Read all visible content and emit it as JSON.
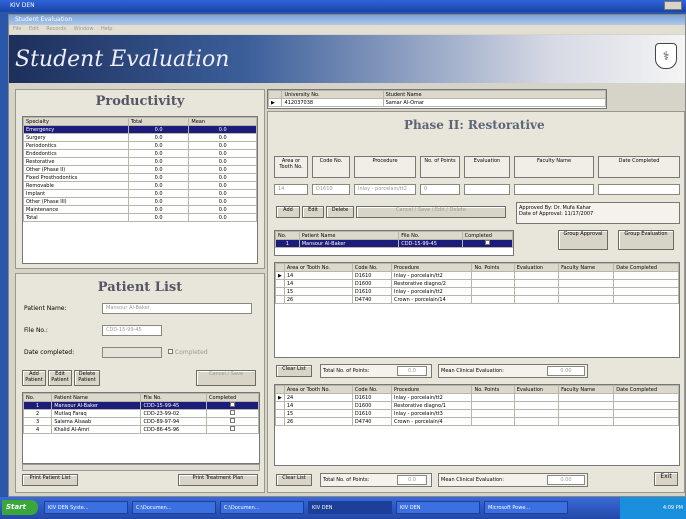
{
  "desktop": {
    "title": "KIV DEN"
  },
  "app": {
    "title": "Student Evaluation",
    "menu": [
      "File",
      "Edit",
      "Records",
      "Window",
      "Help"
    ],
    "banner_title": "Student Evaluation"
  },
  "productivity": {
    "title": "Productivity",
    "columns": [
      "Specialty",
      "Total",
      "Mean"
    ],
    "rows": [
      [
        "Emergency",
        "0.0",
        "0.0"
      ],
      [
        "Surgery",
        "0.0",
        "0.0"
      ],
      [
        "Periodontics",
        "0.0",
        "0.0"
      ],
      [
        "Endodontics",
        "0.0",
        "0.0"
      ],
      [
        "Restorative",
        "0.0",
        "0.0"
      ],
      [
        "Other (Phase II)",
        "0.0",
        "0.0"
      ],
      [
        "Fixed Prosthodontics",
        "0.0",
        "0.0"
      ],
      [
        "Removable",
        "0.0",
        "0.0"
      ],
      [
        "Implant",
        "0.0",
        "0.0"
      ],
      [
        "Other (Phase III)",
        "0.0",
        "0.0"
      ],
      [
        "Maintenance",
        "0.0",
        "0.0"
      ],
      [
        "Total",
        "0.0",
        "0.0"
      ]
    ]
  },
  "patient_list": {
    "title": "Patient List",
    "patient_name_label": "Patient Name:",
    "patient_name_value": "Mansour Al-Baker",
    "file_no_label": "File No.:",
    "file_no_value": "CDD-15-99-45",
    "date_completed_label": "Date completed:",
    "completed_label": "Completed",
    "buttons": {
      "add": "Add Patient",
      "edit": "Edit Patient",
      "delete": "Delete Patient",
      "cancel_save": "Cancel / Save"
    },
    "columns": [
      "No.",
      "Patient Name",
      "File No.",
      "Completed"
    ],
    "rows": [
      [
        "1",
        "Mansour Al-Baker",
        "CDD-15-99-45",
        ""
      ],
      [
        "2",
        "Mutlaq Faraq",
        "CDD-23-99-02",
        ""
      ],
      [
        "3",
        "Salema Alsaab",
        "CDD-89-97-94",
        ""
      ],
      [
        "4",
        "Khalid Al-Amri",
        "CDD-86-45-96",
        ""
      ]
    ],
    "print_patient_list": "Print Patient List",
    "print_treatment_plan": "Print Treatment Plan"
  },
  "student": {
    "university_no_label": "University No.",
    "university_no_value": "412037038",
    "student_name_label": "Student Name",
    "student_name_value": "Samar Al-Omar"
  },
  "phase": {
    "title": "Phase II: Restorative",
    "entry_headers": [
      "Area or Tooth No.",
      "Code No.",
      "Procedure",
      "No. of Points",
      "Evaluation",
      "Faculty Name",
      "Date Completed"
    ],
    "entry_values": [
      "14",
      "D1610",
      "Inlay - porcelain/tt2",
      "0",
      "",
      "",
      ""
    ],
    "buttons": {
      "add": "Add",
      "edit": "Edit",
      "delete": "Delete",
      "cancel_save": "Cancel / Save / Edit / Delete"
    },
    "approved_by_label": "Approved By:",
    "approved_by_value": "Dr. Mufa Kahar",
    "date_of_approval_label": "Date of Approval:",
    "date_of_approval_value": "11/17/2007",
    "patient_table": {
      "columns": [
        "No.",
        "Patient Name",
        "File No.",
        "Completed"
      ],
      "rows": [
        [
          "1",
          "Mansour Al-Baker",
          "CDD-15-99-45",
          ""
        ]
      ]
    },
    "group_approval": "Group Approval",
    "group_evaluation": "Group Evaluation",
    "proc_columns": [
      "Area or Tooth No.",
      "Code No.",
      "Procedure",
      "No. Points",
      "Evaluation",
      "Faculty Name",
      "Date Completed"
    ],
    "proc_rows_top": [
      [
        "14",
        "D1610",
        "Inlay - porcelain/tt2",
        "",
        "",
        "",
        ""
      ],
      [
        "14",
        "D1600",
        "Restorative diagno/2",
        "",
        "",
        "",
        ""
      ],
      [
        "15",
        "D1610",
        "Inlay - porcelain/tt2",
        "",
        "",
        "",
        ""
      ],
      [
        "26",
        "D4740",
        "Crown - porcelain/14",
        "",
        "",
        "",
        ""
      ]
    ],
    "proc_rows_bottom": [
      [
        "24",
        "D1610",
        "Inlay - porcelain/tt2",
        "",
        "",
        "",
        ""
      ],
      [
        "14",
        "D1600",
        "Restorative diagno/1",
        "",
        "",
        "",
        ""
      ],
      [
        "15",
        "D1610",
        "Inlay - porcelain/tt3",
        "",
        "",
        "",
        ""
      ],
      [
        "26",
        "D4740",
        "Crown - porcelain/4",
        "",
        "",
        "",
        ""
      ]
    ],
    "clear_list": "Clear List",
    "total_points_label": "Total No. of Points:",
    "total_points_top": "0.0",
    "mean_eval_label": "Mean Clinical Evaluation:",
    "mean_eval_top": "0.00",
    "total_points_bottom": "0.0",
    "mean_eval_bottom": "0.00",
    "exit": "Exit"
  },
  "taskbar": {
    "start": "Start",
    "tasks": [
      "KIV DEN Syste...",
      "C:\\Documen...",
      "C:\\Documen...",
      "KIV DEN",
      "KIV DEN",
      "Microsoft Powe..."
    ],
    "clock": "4:09 PM"
  }
}
